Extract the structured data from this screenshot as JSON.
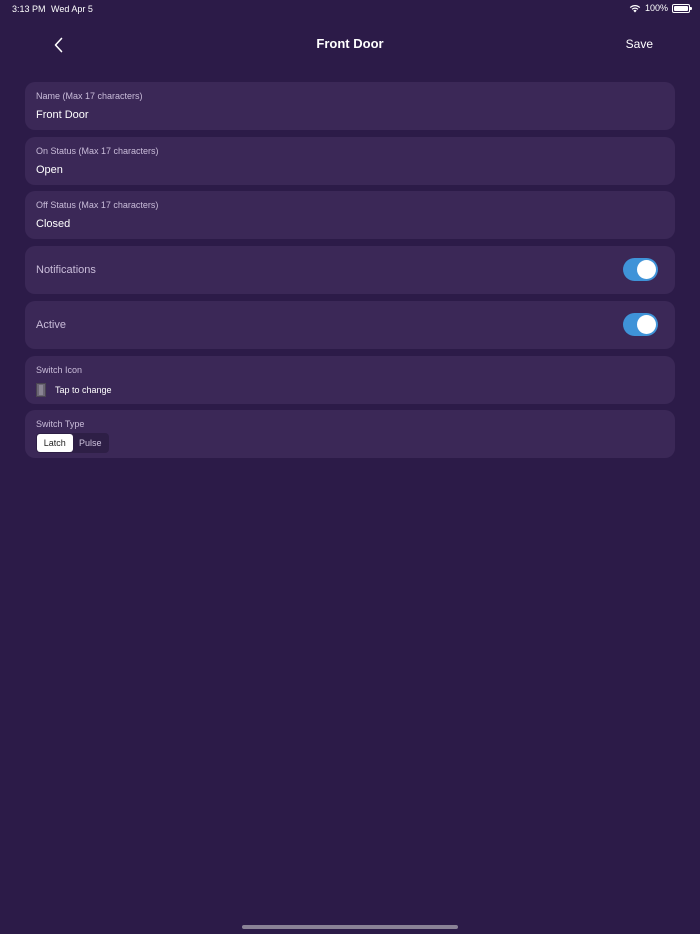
{
  "status_bar": {
    "time": "3:13 PM",
    "date": "Wed Apr 5",
    "battery": "100%",
    "icons": [
      "wifi-icon",
      "battery-icon"
    ]
  },
  "nav": {
    "back_icon": "chevron-left-icon",
    "title": "Front Door",
    "save_label": "Save"
  },
  "fields": {
    "name": {
      "label": "Name (Max 17 characters)",
      "value": "Front Door"
    },
    "on_status": {
      "label": "On Status (Max 17 characters)",
      "value": "Open"
    },
    "off_status": {
      "label": "Off Status (Max 17 characters)",
      "value": "Closed"
    }
  },
  "toggles": {
    "notifications": {
      "label": "Notifications",
      "on": true
    },
    "active": {
      "label": "Active",
      "on": true
    }
  },
  "switch_icon": {
    "label": "Switch Icon",
    "icon": "door-switch-icon",
    "hint": "Tap to change"
  },
  "switch_type": {
    "label": "Switch Type",
    "options": [
      "Latch",
      "Pulse"
    ],
    "selected": "Latch"
  },
  "colors": {
    "background": "#2c1b48",
    "card": "#3b2857",
    "toggle_on": "#3f93d8"
  }
}
